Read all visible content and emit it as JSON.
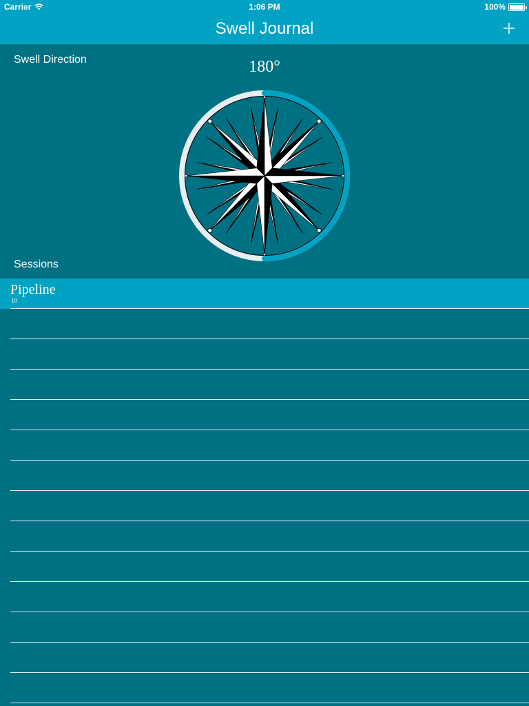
{
  "status_bar": {
    "carrier": "Carrier",
    "time": "1:06 PM",
    "battery": "100%",
    "battery_level": 1.0
  },
  "nav": {
    "title": "Swell Journal",
    "add_icon": "plus-icon"
  },
  "swell": {
    "label": "Swell Direction",
    "degrees": "180°",
    "value": 180,
    "compass_icon": "compass-rose-icon"
  },
  "sessions": {
    "label": "Sessions",
    "items": [
      {
        "name": "Pipeline",
        "count": "10",
        "selected": true
      },
      {
        "name": "",
        "count": ""
      },
      {
        "name": "",
        "count": ""
      },
      {
        "name": "",
        "count": ""
      },
      {
        "name": "",
        "count": ""
      },
      {
        "name": "",
        "count": ""
      },
      {
        "name": "",
        "count": ""
      },
      {
        "name": "",
        "count": ""
      },
      {
        "name": "",
        "count": ""
      },
      {
        "name": "",
        "count": ""
      },
      {
        "name": "",
        "count": ""
      },
      {
        "name": "",
        "count": ""
      },
      {
        "name": "",
        "count": ""
      },
      {
        "name": "",
        "count": ""
      }
    ]
  },
  "colors": {
    "background": "#007183",
    "accent": "#00a3c3",
    "ring_track": "#e8eef0",
    "divider": "#dfe9ec"
  }
}
